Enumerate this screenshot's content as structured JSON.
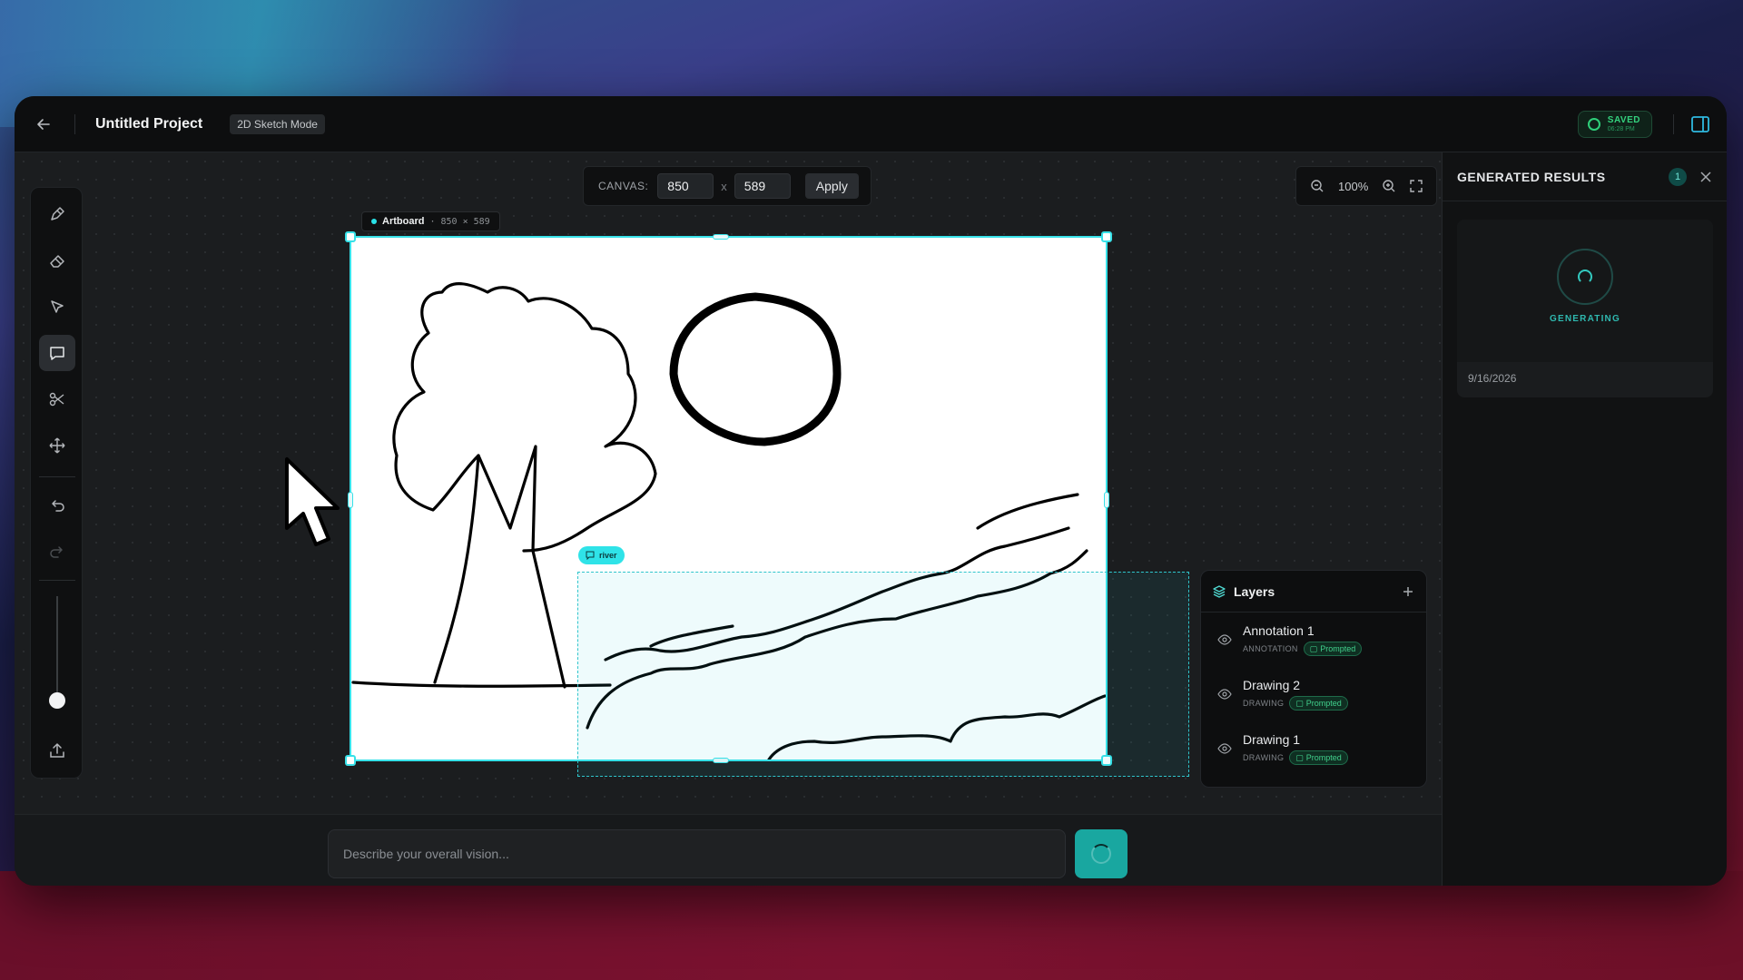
{
  "header": {
    "project_title": "Untitled Project",
    "mode": "2D Sketch Mode",
    "saved_label": "SAVED",
    "saved_time": "06:28 PM"
  },
  "canvas": {
    "label": "CANVAS:",
    "width_value": "850",
    "height_value": "589",
    "x_sep": "x",
    "apply_label": "Apply",
    "zoom": "100%"
  },
  "artboard": {
    "name": "Artboard",
    "dims": "· 850 × 589"
  },
  "annotation": {
    "tag": "river"
  },
  "layers": {
    "title": "Layers",
    "items": [
      {
        "name": "Annotation 1",
        "type": "ANNOTATION",
        "badge": "Prompted"
      },
      {
        "name": "Drawing 2",
        "type": "DRAWING",
        "badge": "Prompted"
      },
      {
        "name": "Drawing 1",
        "type": "DRAWING",
        "badge": "Prompted"
      }
    ]
  },
  "prompt": {
    "placeholder": "Describe your overall vision..."
  },
  "results": {
    "title": "GENERATED RESULTS",
    "count": "1",
    "status": "GENERATING",
    "date": "9/16/2026"
  },
  "colors": {
    "accent_cyan": "#37e1e8",
    "saved_green": "#34d27e",
    "generate_teal": "#19a7a0"
  },
  "icons": [
    "back-arrow-icon",
    "pen-icon",
    "eraser-icon",
    "select-arrow-icon",
    "comment-icon",
    "scissors-icon",
    "move-icon",
    "undo-icon",
    "redo-icon",
    "upload-icon",
    "zoom-out-icon",
    "zoom-in-icon",
    "fullscreen-icon",
    "layers-icon",
    "plus-icon",
    "eye-icon",
    "close-icon",
    "panel-toggle-icon",
    "spinner-icon"
  ]
}
